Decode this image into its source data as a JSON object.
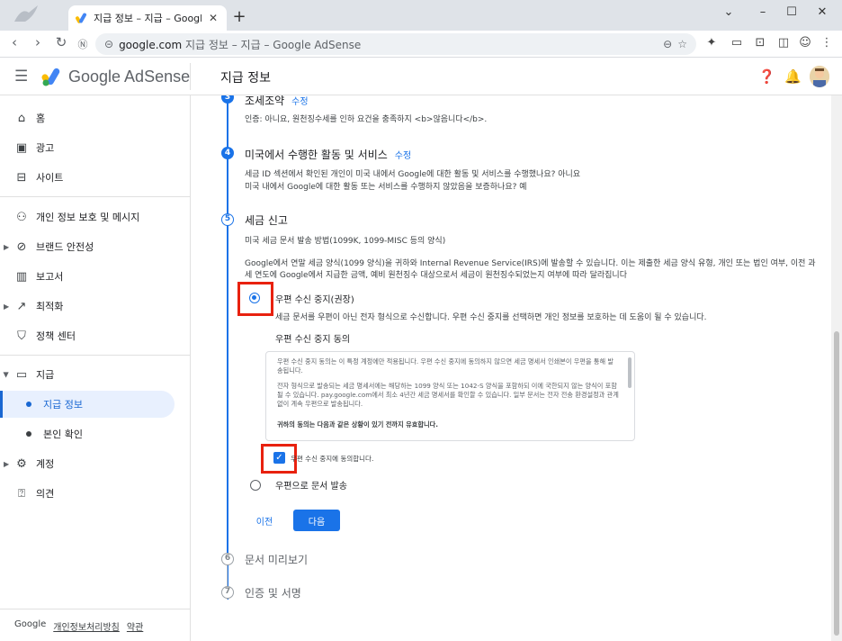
{
  "browser": {
    "tab_title": "지급 정보 – 지급 – Google AdSense",
    "url_host": "google.com",
    "url_rest": " 지급 정보 – 지급 – Google AdSense"
  },
  "app": {
    "product": "Google AdSense",
    "page_title": "지급 정보"
  },
  "sidebar": {
    "items": [
      {
        "label": "홈",
        "icon": "home-icon"
      },
      {
        "label": "광고",
        "icon": "ads-icon"
      },
      {
        "label": "사이트",
        "icon": "sites-icon"
      },
      {
        "label": "개인 정보 보호 및 메시지",
        "icon": "privacy-icon"
      },
      {
        "label": "브랜드 안전성",
        "icon": "block-icon"
      },
      {
        "label": "보고서",
        "icon": "reports-icon"
      },
      {
        "label": "최적화",
        "icon": "trending-icon"
      },
      {
        "label": "정책 센터",
        "icon": "policy-icon"
      },
      {
        "label": "지급",
        "icon": "payments-icon"
      },
      {
        "label": "지급 정보",
        "icon": "dot"
      },
      {
        "label": "본인 확인",
        "icon": "dot"
      },
      {
        "label": "계정",
        "icon": "gear-icon"
      },
      {
        "label": "의견",
        "icon": "feedback-icon"
      }
    ],
    "footer": {
      "brand": "Google",
      "privacy": "개인정보처리방침",
      "terms": "약관"
    }
  },
  "steps": {
    "s3": {
      "number": "3",
      "title": "조세조약",
      "edit": "수정",
      "desc": "인증: 아니요, 원천징수세를 인하 요건을 충족하지 <b>않음니다</b>."
    },
    "s4": {
      "number": "4",
      "title": "미국에서 수행한 활동 및 서비스",
      "edit": "수정",
      "desc1": "세금 ID 섹션에서 확인된 개인이 미국 내에서 Google에 대한 활동 및 서비스를 수행했나요? 아니요",
      "desc2": "미국 내에서 Google에 대한 활동 또는 서비스를 수행하지 않았음을 보증하나요? 예"
    },
    "s5": {
      "number": "5",
      "title": "세금 신고",
      "subtitle": "미국 세금 문서 발송 방법(1099K, 1099-MISC 등의 양식)",
      "desc": "Google에서 연말 세금 양식(1099 양식)을 귀하와 Internal Revenue Service(IRS)에 발송할 수 있습니다. 이는 제출한 세금 양식 유형, 개인 또는 법인 여부, 이전 과세 연도에 Google에서 지급한 금액, 예비 원천징수 대상으로서 세금이 원천징수되었는지 여부에 따라 달라집니다",
      "option1": "우편 수신 중지(권장)",
      "option1_desc": "세금 문서를 우편이 아닌 전자 형식으로 수신합니다. 우편 수신 중지를 선택하면 개인 정보를 보호하는 데 도움이 될 수 있습니다.",
      "consent_heading": "우편 수신 중지 동의",
      "consent_p1": "우편 수신 중지 동의는 이 특정 계정에만 적용됩니다. 우편 수신 중지에 동의하지 않으면 세금 명세서 인쇄본이 우편을 통해 발송됩니다.",
      "consent_p2": "전자 형식으로 발송되는 세금 명세서에는 해당하는 1099 양식 또는 1042-S 양식을 포함하되 이에 국한되지 않는 양식이 포함될 수 있습니다. pay.google.com에서 최소 4년간 세금 명세서를 확인할 수 있습니다. 일부 문서는 전자 전송 환경설정과 관계없이 계속 우편으로 발송됩니다.",
      "consent_p3": "귀하의 동의는 다음과 같은 상황이 있기 전까지 유효합니다.",
      "checkbox_label": "우편 수신 중지에 동의합니다.",
      "option2": "우편으로 문서 발송",
      "prev": "이전",
      "next": "다음"
    },
    "s6": {
      "number": "6",
      "title": "문서 미리보기"
    },
    "s7": {
      "number": "7",
      "title": "인증 및 서명"
    }
  },
  "colors": {
    "accent": "#1a73e8",
    "highlight": "#e8210f"
  }
}
